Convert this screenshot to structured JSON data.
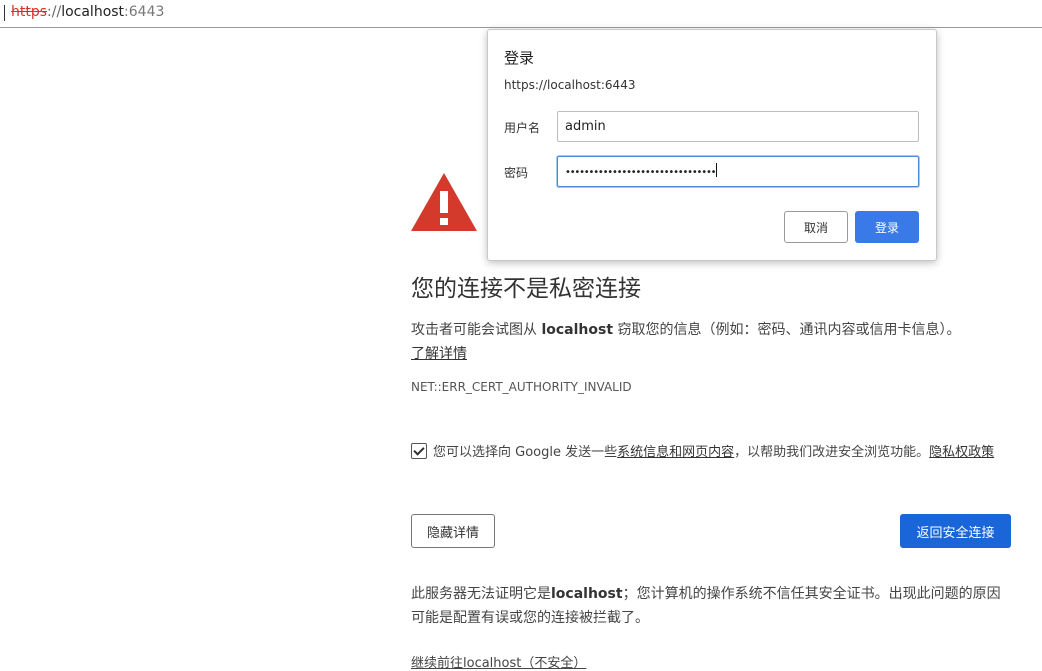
{
  "address_bar": {
    "scheme": "https",
    "separator": "://",
    "host": "localhost",
    "port": ":6443"
  },
  "interstitial": {
    "title": "您的连接不是私密连接",
    "description_prefix": "攻击者可能会试图从",
    "description_host": "localhost",
    "description_suffix": "窃取您的信息（例如：密码、通讯内容或信用卡信息）。",
    "learn_more": "了解详情",
    "error_code": "NET::ERR_CERT_AUTHORITY_INVALID",
    "optin_prefix": "您可以选择向 Google 发送一些",
    "optin_link": "系统信息和网页内容",
    "optin_middle": "，以帮助我们改进安全浏览功能。",
    "privacy_link": "隐私权政策",
    "optin_checked": true,
    "hide_details_button": "隐藏详情",
    "back_button": "返回安全连接",
    "details_prefix": "此服务器无法证明它是",
    "details_host": "localhost",
    "details_suffix": "；您计算机的操作系统不信任其安全证书。出现此问题的原因可能是配置有误或您的连接被拦截了。",
    "proceed_link": "继续前往localhost（不安全）",
    "colors": {
      "warning_red": "#d33a2c",
      "primary_blue": "#1a66d9"
    }
  },
  "login_dialog": {
    "title": "登录",
    "url": "https://localhost:6443",
    "username_label": "用户名",
    "username_value": "admin",
    "password_label": "密码",
    "password_mask": "••••••••••••••••••••••••••••••••",
    "cancel_button": "取消",
    "login_button": "登录"
  }
}
